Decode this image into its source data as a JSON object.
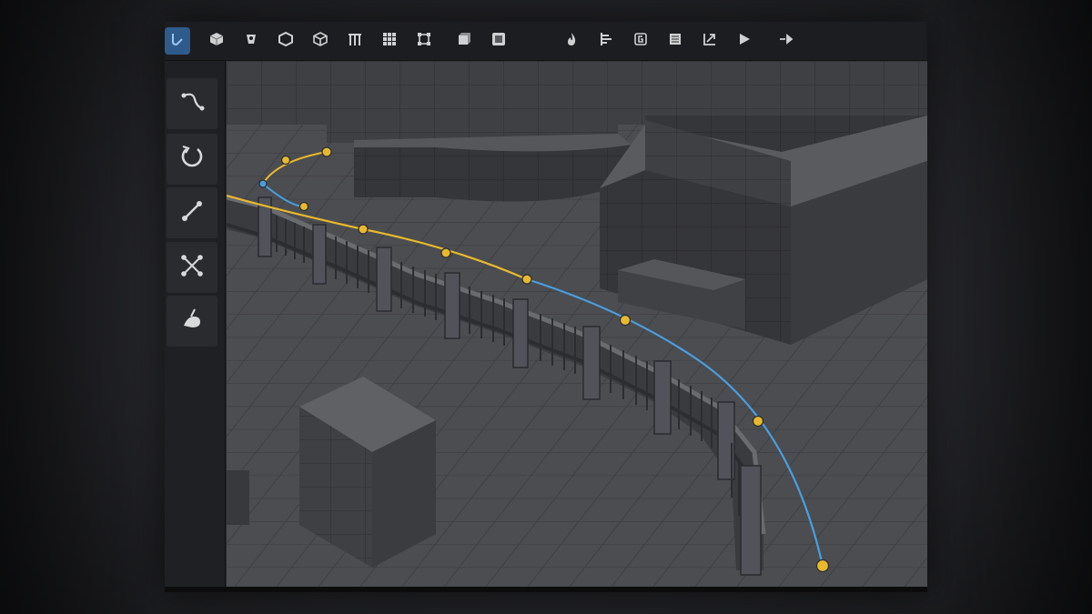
{
  "colors": {
    "accent": "#2f5a8c",
    "spline_yellow": "#e8b92e",
    "spline_blue": "#4a9ee0",
    "floor": "#4d4e52"
  },
  "toolbar": {
    "items": [
      {
        "icon": "spline-select-icon",
        "active": true
      },
      {
        "icon": "cube-add-icon"
      },
      {
        "icon": "bucket-icon"
      },
      {
        "icon": "box-tool-icon"
      },
      {
        "icon": "mesh-icon"
      },
      {
        "icon": "pillar-icon"
      },
      {
        "icon": "grid-icon"
      },
      {
        "icon": "transform-box-icon"
      },
      {
        "icon": "solid-cube-icon"
      },
      {
        "icon": "square-frame-icon"
      },
      {
        "icon": "fire-icon"
      },
      {
        "icon": "align-icon"
      },
      {
        "icon": "snap-icon"
      },
      {
        "icon": "layers-icon"
      },
      {
        "icon": "measure-icon"
      },
      {
        "icon": "play-icon"
      },
      {
        "icon": "step-icon"
      }
    ]
  },
  "left_tools": [
    {
      "icon": "spline-path-icon"
    },
    {
      "icon": "rotate-icon"
    },
    {
      "icon": "line-segment-icon"
    },
    {
      "icon": "scale-points-icon"
    },
    {
      "icon": "sculpt-icon"
    }
  ],
  "viewport": {
    "spline_points": 10,
    "object": "fence"
  }
}
